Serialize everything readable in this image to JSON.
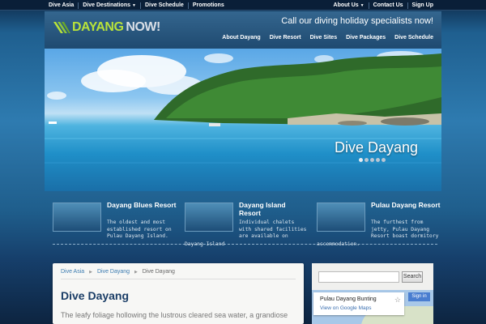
{
  "topbar": {
    "left": [
      {
        "label": "Dive Asia"
      },
      {
        "label": "Dive Destinations",
        "has_caret": true
      },
      {
        "label": "Dive Schedule"
      },
      {
        "label": "Promotions"
      }
    ],
    "right": [
      {
        "label": "About Us",
        "has_caret": true
      },
      {
        "label": "Contact Us"
      },
      {
        "label": "Sign Up"
      }
    ]
  },
  "header": {
    "logo_part1": "DAYANG",
    "logo_part2": "NOW!",
    "tagline": "Call our diving holiday specialists now!",
    "nav": [
      "About Dayang",
      "Dive Resort",
      "Dive Sites",
      "Dive Packages",
      "Dive Schedule"
    ]
  },
  "hero": {
    "caption": "Dive Dayang",
    "slide_count": 5,
    "active_slide": 1
  },
  "teasers": [
    {
      "title": "Dayang Blues Resort",
      "text": "The oldest and most established resort on Pulau Dayang Island."
    },
    {
      "title": "Dayang Island Resort",
      "text": "Individual chalets with shared facilities are available on"
    },
    {
      "title": "Pulau Dayang Resort",
      "text": "The furthest from jetty, Pulau Dayang Resort boast dormitory"
    }
  ],
  "separator_labels": [
    "Dayang Island",
    "accommodation."
  ],
  "breadcrumbs": [
    "Dive Asia",
    "Dive Dayang",
    "Dive Dayang"
  ],
  "page_title": "Dive Dayang",
  "intro_text": "The leafy foliage hollowing the lustrous cleared sea water, a grandiose",
  "sidebar": {
    "search_button": "Search",
    "search_value": "",
    "map": {
      "title": "Pulau Dayang Bunting",
      "link": "View on Google Maps",
      "sign_in": "Sign in",
      "star": "☆"
    }
  },
  "colors": {
    "logo_green": "#b8e23a",
    "link_blue": "#3b7bb0",
    "title_blue": "#1a3d66"
  }
}
